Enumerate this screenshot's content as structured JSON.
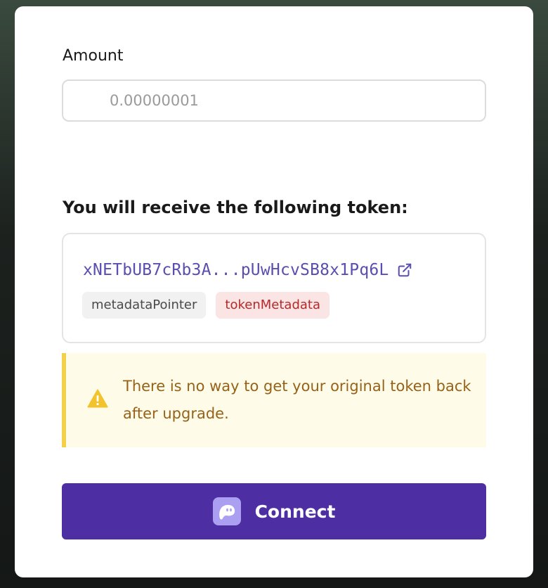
{
  "amount": {
    "label": "Amount",
    "value": "",
    "placeholder": "0.00000001"
  },
  "receive": {
    "title": "You will receive the following token:",
    "token_address": "xNETbUB7cRb3A...pUwHcvSB8x1Pq6L",
    "link_icon": "external-link-icon",
    "tags": [
      "metadataPointer",
      "tokenMetadata"
    ]
  },
  "warning": {
    "icon": "warning-triangle-icon",
    "text": "There is no way to get your original token back after upgrade."
  },
  "connect": {
    "label": "Connect",
    "icon": "phantom-ghost-icon"
  },
  "colors": {
    "primary": "#4d2fa3",
    "token_link": "#5a4eb0",
    "warning_bg": "#fefce8",
    "warning_border": "#f2d04a",
    "warning_text": "#96621a",
    "tag_red_bg": "#fbe4e4",
    "tag_red_text": "#b42a2a"
  }
}
